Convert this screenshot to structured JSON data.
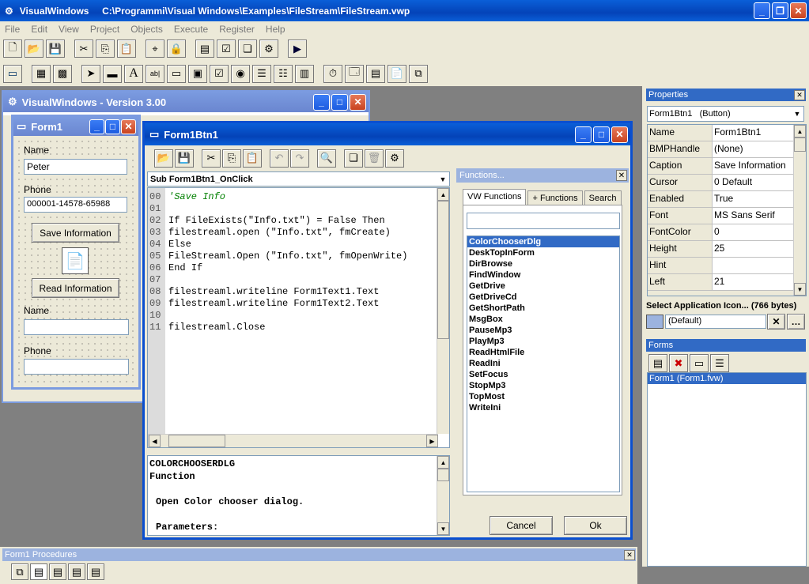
{
  "main_window": {
    "title": "VisualWindows     C:\\Programmi\\Visual Windows\\Examples\\FileStream\\FileStream.vwp"
  },
  "menu": [
    "File",
    "Edit",
    "View",
    "Project",
    "Objects",
    "Execute",
    "Register",
    "Help"
  ],
  "version_window": {
    "title": "VisualWindows - Version 3.00"
  },
  "form1": {
    "title": "Form1",
    "name_label": "Name",
    "name_value": "Peter",
    "phone_label": "Phone",
    "phone_value": "000001-14578-65988",
    "save_button": "Save Information",
    "read_button": "Read Information",
    "name_label2": "Name",
    "phone_label2": "Phone"
  },
  "editor": {
    "title": "Form1Btn1",
    "sub_select": "Sub Form1Btn1_OnClick",
    "lines": [
      {
        "n": "00",
        "t": "'Save Info"
      },
      {
        "n": "01",
        "t": ""
      },
      {
        "n": "02",
        "t": "If FileExists(\"Info.txt\") = False Then"
      },
      {
        "n": "03",
        "t": "filestreaml.open (\"Info.txt\", fmCreate)"
      },
      {
        "n": "04",
        "t": "Else"
      },
      {
        "n": "05",
        "t": "FileStreaml.Open (\"Info.txt\", fmOpenWrite)"
      },
      {
        "n": "06",
        "t": "End If"
      },
      {
        "n": "07",
        "t": ""
      },
      {
        "n": "08",
        "t": "filestreaml.writeline Form1Text1.Text"
      },
      {
        "n": "09",
        "t": "filestreaml.writeline Form1Text2.Text"
      },
      {
        "n": "10",
        "t": ""
      },
      {
        "n": "11",
        "t": "filestreaml.Close"
      }
    ],
    "help_lines": [
      "COLORCHOOSERDLG",
      "Function",
      "",
      "Open Color chooser dialog.",
      "",
      "Parameters:"
    ]
  },
  "functions": {
    "title": "Functions...",
    "tabs": [
      "VW Functions",
      "+ Functions",
      "Search"
    ],
    "items": [
      "ColorChooserDlg",
      "DeskTopInForm",
      "DirBrowse",
      "FindWindow",
      "GetDrive",
      "GetDriveCd",
      "GetShortPath",
      "MsgBox",
      "PauseMp3",
      "PlayMp3",
      "ReadHtmlFile",
      "ReadIni",
      "SetFocus",
      "StopMp3",
      "TopMost",
      "WriteIni"
    ],
    "cancel": "Cancel",
    "ok": "Ok"
  },
  "properties": {
    "title": "Properties",
    "object": "Form1Btn1   (Button)",
    "rows": [
      [
        "Name",
        "Form1Btn1"
      ],
      [
        "BMPHandle",
        "(None)"
      ],
      [
        "Caption",
        "Save Information"
      ],
      [
        "Cursor",
        "0 Default"
      ],
      [
        "Enabled",
        "True"
      ],
      [
        "Font",
        "MS Sans Serif"
      ],
      [
        "FontColor",
        "0"
      ],
      [
        "Height",
        "25"
      ],
      [
        "Hint",
        ""
      ],
      [
        "Left",
        "21"
      ]
    ],
    "icon_label": "Select Application Icon... (766 bytes)",
    "icon_value": "(Default)"
  },
  "forms": {
    "title": "Forms",
    "items": [
      "Form1 (Form1.fvw)"
    ]
  },
  "procedures": {
    "title": "Form1 Procedures"
  }
}
